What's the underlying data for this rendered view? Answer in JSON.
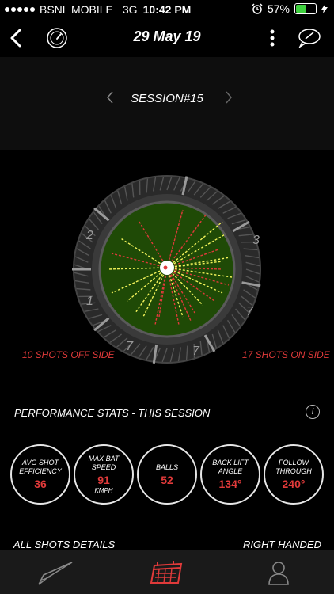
{
  "status": {
    "carrier": "BSNL MOBILE",
    "network": "3G",
    "time": "10:42 PM",
    "battery": "57%",
    "battery_level": 0.57
  },
  "header": {
    "title": "29 May 19"
  },
  "session": {
    "label": "SESSION#15"
  },
  "field": {
    "zone_labels": [
      "2",
      "3",
      "1",
      "7",
      "7",
      "7"
    ]
  },
  "shots": {
    "off_side": "10 SHOTS OFF SIDE",
    "on_side": "17 SHOTS ON SIDE"
  },
  "performance": {
    "title": "PERFORMANCE STATS - THIS SESSION",
    "info": "i",
    "stats": [
      {
        "label": "AVG SHOT\nEFFICIENCY",
        "value": "36",
        "unit": ""
      },
      {
        "label": "MAX BAT\nSPEED",
        "value": "91",
        "unit": "KMPH"
      },
      {
        "label": "BALLS",
        "value": "52",
        "unit": ""
      },
      {
        "label": "BACK LIFT\nANGLE",
        "value": "134°",
        "unit": ""
      },
      {
        "label": "FOLLOW\nTHROUGH",
        "value": "240°",
        "unit": ""
      }
    ]
  },
  "details": {
    "left": "ALL SHOTS DETAILS",
    "right": "RIGHT HANDED"
  },
  "colors": {
    "accent": "#e03a3a",
    "field_green": "#1f4a06",
    "shot_yellow": "#f2f25a",
    "shot_red": "#e03a3a"
  }
}
